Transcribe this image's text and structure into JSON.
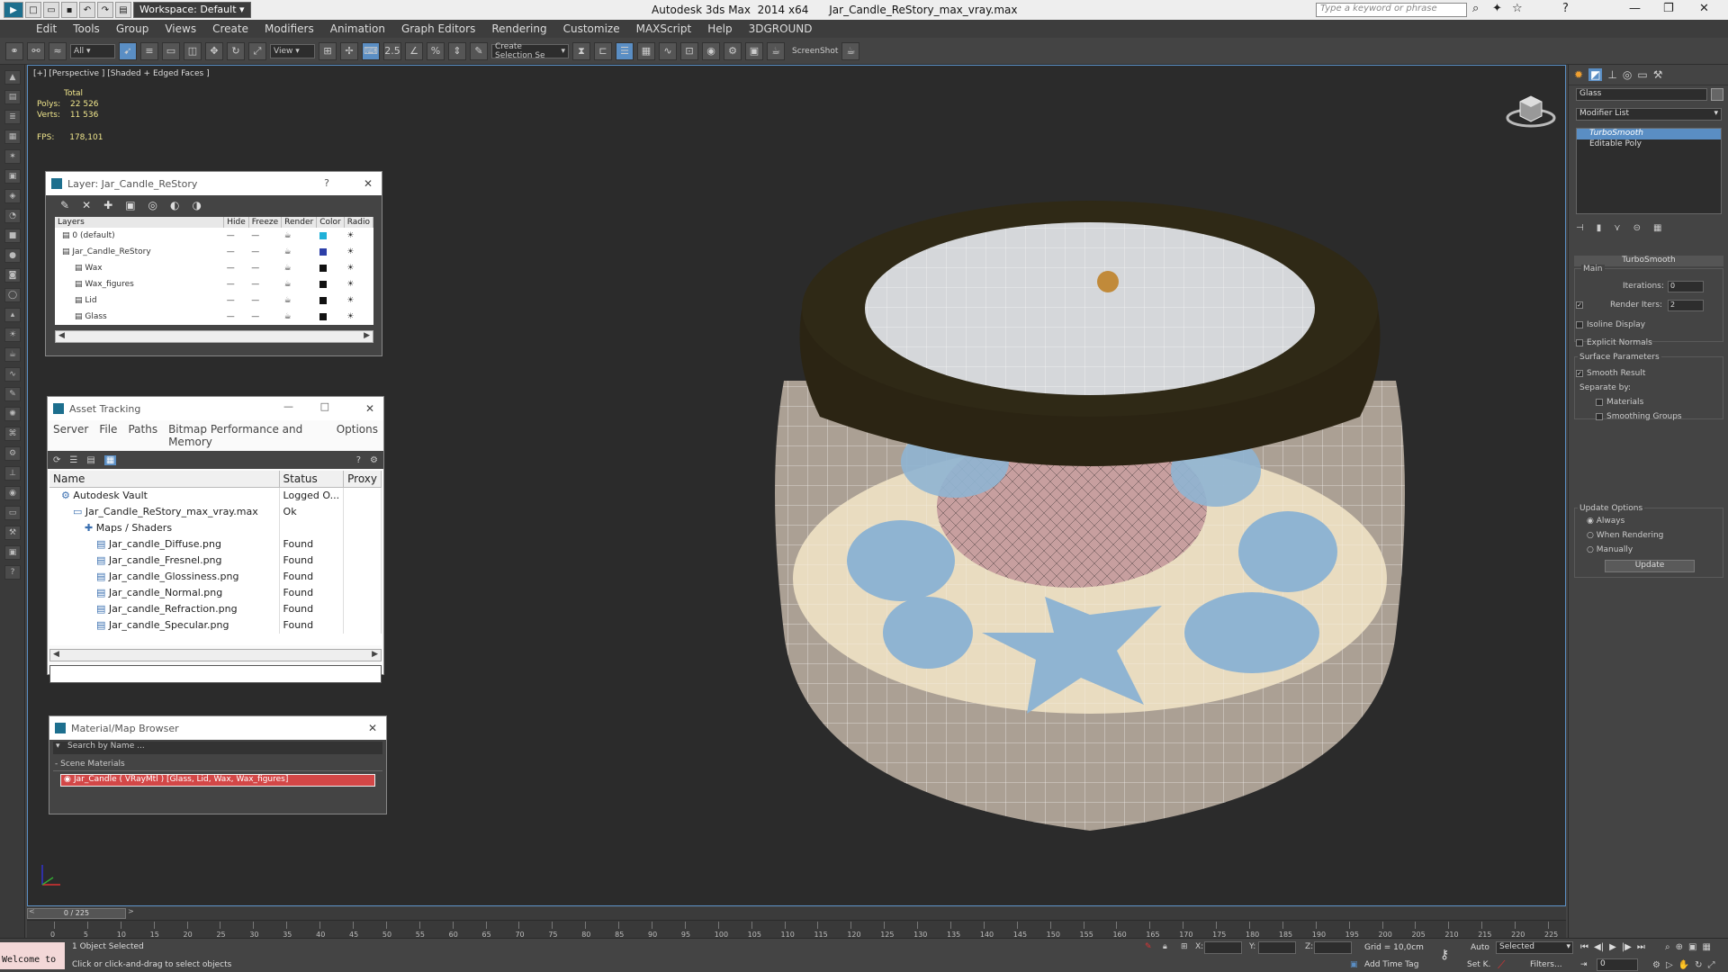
{
  "app": {
    "title": "Autodesk 3ds Max  2014 x64      Jar_Candle_ReStory_max_vray.max",
    "workspace": "Workspace: Default",
    "search_placeholder": "Type a keyword or phrase"
  },
  "menu": [
    "Edit",
    "Tools",
    "Group",
    "Views",
    "Create",
    "Modifiers",
    "Animation",
    "Graph Editors",
    "Rendering",
    "Customize",
    "MAXScript",
    "Help",
    "3DGROUND"
  ],
  "toolbar": {
    "filter": "All",
    "ref_coord": "View",
    "selection_set": "Create Selection Se",
    "screenshot": "ScreenShot"
  },
  "viewport": {
    "label": "[+] [Perspective ] [Shaded + Edged Faces ]",
    "stats_total": "Total",
    "polys_label": "Polys:",
    "polys": "22 526",
    "verts_label": "Verts:",
    "verts": "11 536",
    "fps_label": "FPS:",
    "fps": "178,101"
  },
  "layer_panel": {
    "title": "Layer: Jar_Candle_ReStory",
    "help": "?",
    "columns": [
      "Layers",
      "Hide",
      "Freeze",
      "Render",
      "Color",
      "Radio"
    ],
    "rows": [
      {
        "name": "0 (default)",
        "color": "#1fb0d8",
        "indent": 1
      },
      {
        "name": "Jar_Candle_ReStory",
        "color": "#2c3fa8",
        "indent": 1
      },
      {
        "name": "Wax",
        "color": "#111111",
        "indent": 2
      },
      {
        "name": "Wax_figures",
        "color": "#111111",
        "indent": 2
      },
      {
        "name": "Lid",
        "color": "#111111",
        "indent": 2
      },
      {
        "name": "Glass",
        "color": "#111111",
        "indent": 2
      }
    ]
  },
  "asset_panel": {
    "title": "Asset Tracking",
    "menu": [
      "Server",
      "File",
      "Paths",
      "Bitmap Performance and Memory",
      "Options"
    ],
    "columns": [
      "Name",
      "Status",
      "Proxy"
    ],
    "rows": [
      {
        "name": "Autodesk Vault",
        "status": "Logged O...",
        "indent": 1
      },
      {
        "name": "Jar_Candle_ReStory_max_vray.max",
        "status": "Ok",
        "indent": 2
      },
      {
        "name": "Maps / Shaders",
        "status": "",
        "indent": 3
      },
      {
        "name": "Jar_candle_Diffuse.png",
        "status": "Found",
        "indent": 4
      },
      {
        "name": "Jar_candle_Fresnel.png",
        "status": "Found",
        "indent": 4
      },
      {
        "name": "Jar_candle_Glossiness.png",
        "status": "Found",
        "indent": 4
      },
      {
        "name": "Jar_candle_Normal.png",
        "status": "Found",
        "indent": 4
      },
      {
        "name": "Jar_candle_Refraction.png",
        "status": "Found",
        "indent": 4
      },
      {
        "name": "Jar_candle_Specular.png",
        "status": "Found",
        "indent": 4
      }
    ]
  },
  "material_panel": {
    "title": "Material/Map Browser",
    "search_placeholder": "Search by Name ...",
    "section": "- Scene Materials",
    "item": "Jar_Candle  ( VRayMtl ) [Glass, Lid, Wax, Wax_figures]"
  },
  "command_panel": {
    "object_name": "Glass",
    "modifier_list": "Modifier List",
    "stack": [
      "TurboSmooth",
      "Editable Poly"
    ],
    "rollout": "TurboSmooth",
    "main": "Main",
    "iterations_label": "Iterations:",
    "iterations": "0",
    "render_iters_label": "Render Iters:",
    "render_iters": "2",
    "isoline": "Isoline Display",
    "explicit": "Explicit Normals",
    "surface": "Surface Parameters",
    "smooth_result": "Smooth Result",
    "separate_by": "Separate by:",
    "materials": "Materials",
    "smoothing_groups": "Smoothing Groups",
    "update_options": "Update Options",
    "always": "Always",
    "when_rendering": "When Rendering",
    "manually": "Manually",
    "update": "Update"
  },
  "timeline": {
    "frame": "0 / 225",
    "ticks": [
      "0",
      "5",
      "10",
      "15",
      "20",
      "25",
      "30",
      "35",
      "40",
      "45",
      "50",
      "55",
      "60",
      "65",
      "70",
      "75",
      "80",
      "85",
      "90",
      "95",
      "100",
      "105",
      "110",
      "115",
      "120",
      "125",
      "130",
      "135",
      "140",
      "145",
      "150",
      "155",
      "160",
      "165",
      "170",
      "175",
      "180",
      "185",
      "190",
      "195",
      "200",
      "205",
      "210",
      "215",
      "220",
      "225"
    ]
  },
  "status": {
    "welcome": "Welcome to",
    "selected": "1 Object Selected",
    "hint": "Click or click-and-drag to select objects",
    "x_label": "X:",
    "y_label": "Y:",
    "z_label": "Z:",
    "grid": "Grid = 10,0cm",
    "add_time_tag": "Add Time Tag",
    "auto": "Auto",
    "set_k": "Set K.",
    "key_mode": "Selected",
    "filters": "Filters...",
    "cur_frame": "0"
  }
}
